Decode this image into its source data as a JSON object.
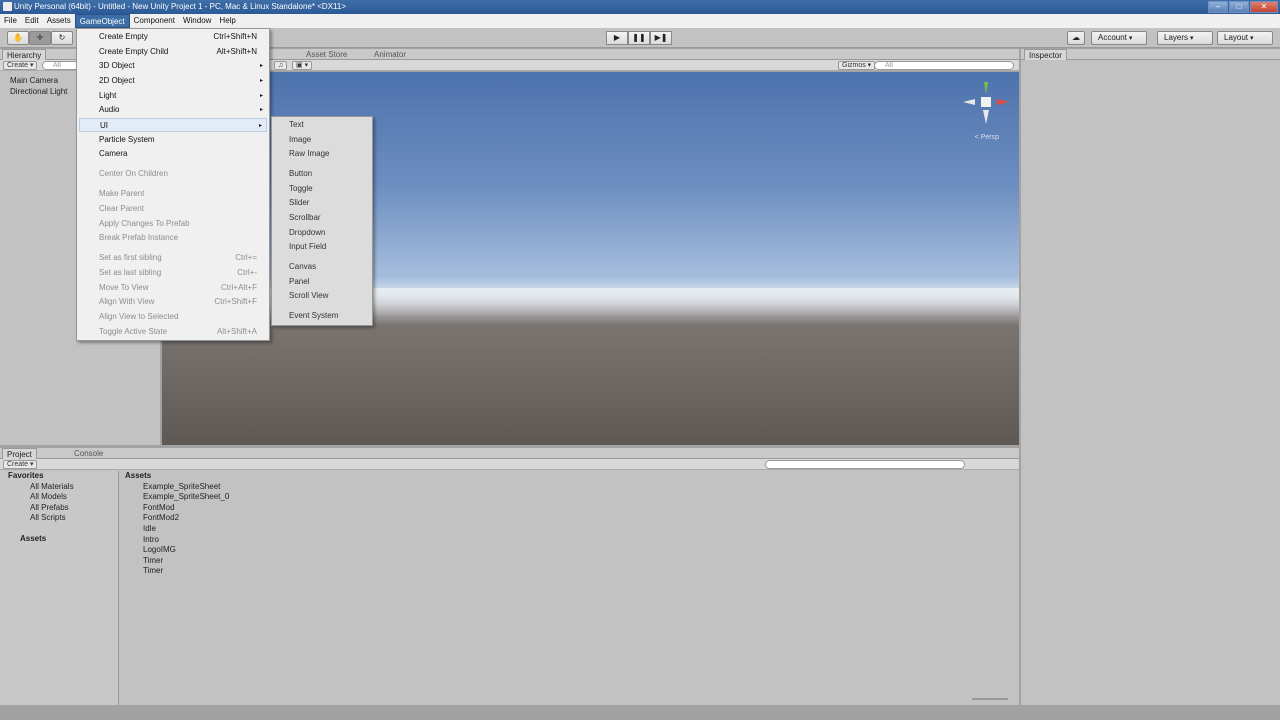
{
  "window": {
    "title": "Unity Personal (64bit) - Untitled - New Unity Project 1 - PC, Mac & Linux Standalone* <DX11>",
    "buttons": [
      "–",
      "□",
      "✕"
    ]
  },
  "menubar": [
    "File",
    "Edit",
    "Assets",
    "GameObject",
    "Component",
    "Window",
    "Help"
  ],
  "toolbar": {
    "tools": [
      "✋",
      "✛",
      "↻"
    ],
    "play": [
      "▶",
      "❚❚",
      "▶❚"
    ],
    "account": "Account",
    "layers": "Layers",
    "layout": "Layout",
    "cloud": "☁"
  },
  "hierarchy": {
    "tab": "Hierarchy",
    "create": "Create",
    "search": "All",
    "items": [
      "Main Camera",
      "Directional Light"
    ]
  },
  "scene": {
    "tabs": [
      "Asset Store",
      "Animator"
    ],
    "gizmos": "Gizmos",
    "search": "All",
    "persp": "< Persp"
  },
  "inspector": {
    "tab": "Inspector"
  },
  "gameobject_menu": {
    "items": [
      {
        "label": "Create Empty",
        "shortcut": "Ctrl+Shift+N"
      },
      {
        "label": "Create Empty Child",
        "shortcut": "Alt+Shift+N"
      },
      {
        "label": "3D Object",
        "arrow": "▸"
      },
      {
        "label": "2D Object",
        "arrow": "▸"
      },
      {
        "label": "Light",
        "arrow": "▸"
      },
      {
        "label": "Audio",
        "arrow": "▸"
      },
      {
        "label": "UI",
        "arrow": "▸"
      },
      {
        "label": "Particle System"
      },
      {
        "label": "Camera"
      },
      {
        "label": "Center On Children"
      },
      {
        "label": "Make Parent"
      },
      {
        "label": "Clear Parent"
      },
      {
        "label": "Apply Changes To Prefab"
      },
      {
        "label": "Break Prefab Instance"
      },
      {
        "label": "Set as first sibling",
        "shortcut": "Ctrl+="
      },
      {
        "label": "Set as last sibling",
        "shortcut": "Ctrl+-"
      },
      {
        "label": "Move To View",
        "shortcut": "Ctrl+Alt+F"
      },
      {
        "label": "Align With View",
        "shortcut": "Ctrl+Shift+F"
      },
      {
        "label": "Align View to Selected"
      },
      {
        "label": "Toggle Active State",
        "shortcut": "Alt+Shift+A"
      }
    ]
  },
  "ui_submenu": {
    "items": [
      "Text",
      "Image",
      "Raw Image",
      "Button",
      "Toggle",
      "Slider",
      "Scrollbar",
      "Dropdown",
      "Input Field",
      "Canvas",
      "Panel",
      "Scroll View",
      "Event System"
    ]
  },
  "project": {
    "tabs": [
      "Project",
      "Console"
    ],
    "create": "Create",
    "favorites_label": "Favorites",
    "favorites": [
      "All Materials",
      "All Models",
      "All Prefabs",
      "All Scripts"
    ],
    "assets_label": "Assets",
    "breadcrumb": "Assets",
    "assets": [
      {
        "name": "Example_SpriteSheet",
        "icon": "sprite-icon"
      },
      {
        "name": "Example_SpriteSheet_0",
        "icon": "prefab-icon"
      },
      {
        "name": "FontMod",
        "icon": "script-icon"
      },
      {
        "name": "FontMod2",
        "icon": "script-icon"
      },
      {
        "name": "Idle",
        "icon": "animation-icon"
      },
      {
        "name": "Intro",
        "icon": "animator-icon"
      },
      {
        "name": "LogoIMG",
        "icon": "image-icon"
      },
      {
        "name": "Timer",
        "icon": "script-icon"
      },
      {
        "name": "Timer",
        "icon": "animator-icon"
      }
    ]
  }
}
